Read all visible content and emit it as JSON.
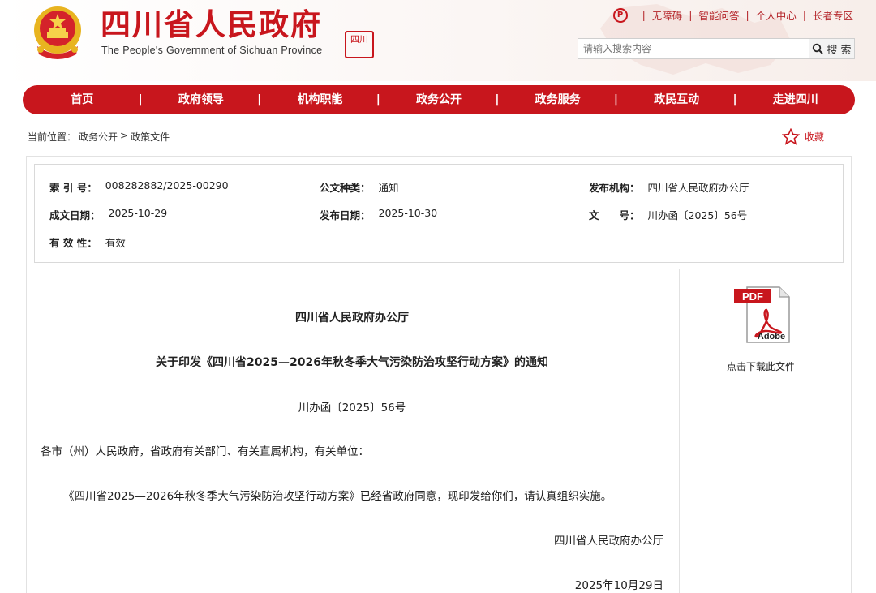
{
  "header": {
    "title_cn": "四川省人民政府",
    "title_en": "The People's Government of Sichuan Province",
    "seal_text": "四川",
    "top_links": [
      "无障碍",
      "智能问答",
      "个人中心",
      "长者专区"
    ],
    "search_placeholder": "请输入搜索内容",
    "search_button": "搜 索"
  },
  "nav": {
    "items": [
      "首页",
      "政府领导",
      "机构职能",
      "政务公开",
      "政务服务",
      "政民互动",
      "走进四川"
    ]
  },
  "breadcrumb": {
    "prefix": "当前位置：",
    "items": [
      "政务公开",
      ">",
      "政策文件"
    ]
  },
  "favorite_label": "收藏",
  "meta": {
    "index_label": "索 引 号：",
    "index_value": "008282882/2025-00290",
    "type_label": "公文种类：",
    "type_value": "通知",
    "org_label": "发布机构：",
    "org_value": "四川省人民政府办公厅",
    "created_label": "成文日期：",
    "created_value": "2025-10-29",
    "published_label": "发布日期：",
    "published_value": "2025-10-30",
    "docno_label": "文　　号：",
    "docno_value": "川办函〔2025〕56号",
    "validity_label": "有 效 性：",
    "validity_value": "有效"
  },
  "document": {
    "issuer": "四川省人民政府办公厅",
    "title": "关于印发《四川省2025—2026年秋冬季大气污染防治攻坚行动方案》的通知",
    "doc_no": "川办函〔2025〕56号",
    "addressee": "各市（州）人民政府，省政府有关部门、有关直属机构，有关单位：",
    "body": "《四川省2025—2026年秋冬季大气污染防治攻坚行动方案》已经省政府同意，现印发给你们，请认真组织实施。",
    "signature": "四川省人民政府办公厅",
    "date": "2025年10月29日"
  },
  "download": {
    "pdf_tag": "PDF",
    "adobe": "Adobe",
    "label": "点击下载此文件"
  },
  "colors": {
    "brand_red": "#c8161d"
  }
}
